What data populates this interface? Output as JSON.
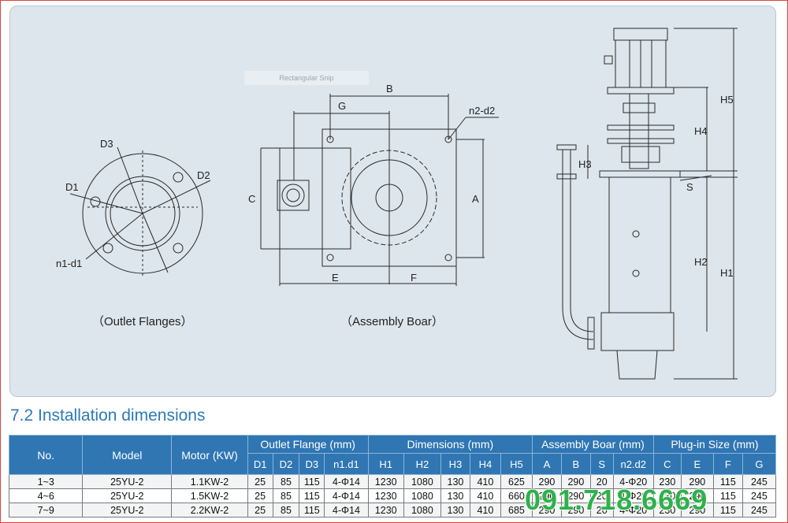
{
  "drawing": {
    "snip_label": "Rectangular Snip",
    "captions": {
      "outlet_flanges": "（Outlet Flanges）",
      "assembly_boar": "（Assembly Boar）"
    },
    "flange_labels": {
      "d3": "D3",
      "d1": "D1",
      "d2": "D2",
      "n1d1": "n1-d1"
    },
    "board_labels": {
      "b": "B",
      "g": "G",
      "n2d2": "n2-d2",
      "c": "C",
      "a": "A",
      "e": "E",
      "f": "F"
    },
    "pump_labels": {
      "h5": "H5",
      "h4": "H4",
      "h3": "H3",
      "s": "S",
      "h2": "H2",
      "h1": "H1"
    }
  },
  "section": {
    "title": "7.2 Installation dimensions"
  },
  "table": {
    "header": {
      "no": "No.",
      "model": "Model",
      "motor": "Motor (KW)",
      "outlet_flange": "Outlet Flange (mm)",
      "dimensions": "Dimensions (mm)",
      "assembly_boar": "Assembly Boar (mm)",
      "plugin_size": "Plug-in Size (mm)"
    },
    "sub_headers": [
      "D1",
      "D2",
      "D3",
      "n1.d1",
      "H1",
      "H2",
      "H3",
      "H4",
      "H5",
      "A",
      "B",
      "S",
      "n2.d2",
      "C",
      "E",
      "F",
      "G"
    ],
    "rows": [
      [
        "1~3",
        "25YU-2",
        "1.1KW-2",
        "25",
        "85",
        "115",
        "4-Φ14",
        "1230",
        "1080",
        "130",
        "410",
        "625",
        "290",
        "290",
        "20",
        "4-Φ20",
        "230",
        "290",
        "115",
        "245"
      ],
      [
        "4~6",
        "25YU-2",
        "1.5KW-2",
        "25",
        "85",
        "115",
        "4-Φ14",
        "1230",
        "1080",
        "130",
        "410",
        "660",
        "290",
        "290",
        "20",
        "4-Φ20",
        "230",
        "290",
        "115",
        "245"
      ],
      [
        "7~9",
        "25YU-2",
        "2.2KW-2",
        "25",
        "85",
        "115",
        "4-Φ14",
        "1230",
        "1080",
        "130",
        "410",
        "685",
        "290",
        "290",
        "20",
        "4-Φ20",
        "230",
        "290",
        "115",
        "245"
      ]
    ]
  },
  "watermark": "091.718.6669",
  "colors": {
    "title": "#2b7ab8",
    "header_bg": "#2f76b3",
    "watermark": "#2db24a",
    "panel_bg": "#dde6ec"
  }
}
